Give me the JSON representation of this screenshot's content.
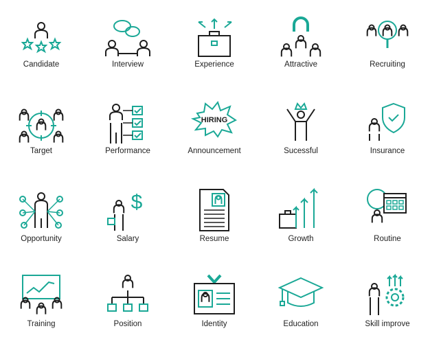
{
  "colors": {
    "accent": "#1aa896",
    "stroke": "#1e1e1e"
  },
  "icons": [
    {
      "label": "Candidate",
      "icon": "candidate-icon"
    },
    {
      "label": "Interview",
      "icon": "interview-icon"
    },
    {
      "label": "Experience",
      "icon": "experience-icon"
    },
    {
      "label": "Attractive",
      "icon": "attractive-icon"
    },
    {
      "label": "Recruiting",
      "icon": "recruiting-icon"
    },
    {
      "label": "Target",
      "icon": "target-icon"
    },
    {
      "label": "Performance",
      "icon": "performance-icon"
    },
    {
      "label": "Announcement",
      "icon": "announcement-icon",
      "badge_text": "HIRING"
    },
    {
      "label": "Sucessful",
      "icon": "successful-icon"
    },
    {
      "label": "Insurance",
      "icon": "insurance-icon"
    },
    {
      "label": "Opportunity",
      "icon": "opportunity-icon"
    },
    {
      "label": "Salary",
      "icon": "salary-icon"
    },
    {
      "label": "Resume",
      "icon": "resume-icon"
    },
    {
      "label": "Growth",
      "icon": "growth-icon"
    },
    {
      "label": "Routine",
      "icon": "routine-icon"
    },
    {
      "label": "Training",
      "icon": "training-icon"
    },
    {
      "label": "Position",
      "icon": "position-icon"
    },
    {
      "label": "Identity",
      "icon": "identity-icon"
    },
    {
      "label": "Education",
      "icon": "education-icon"
    },
    {
      "label": "Skill improve",
      "icon": "skill-improve-icon"
    }
  ]
}
